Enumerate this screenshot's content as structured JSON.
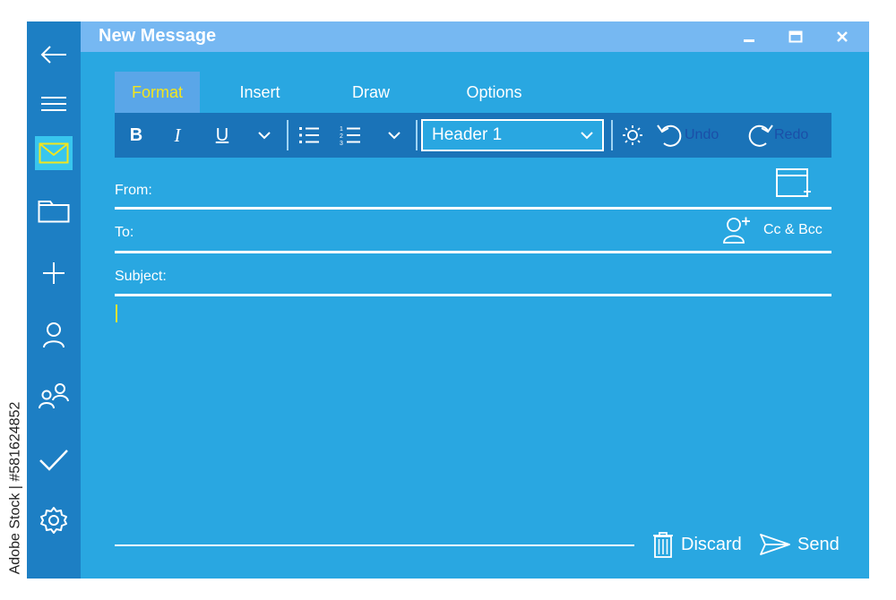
{
  "watermark_side": "Adobe Stock | #581624852",
  "window": {
    "title": "New Message",
    "controls": [
      "minimize",
      "maximize",
      "close"
    ]
  },
  "sidebar": {
    "items": [
      {
        "icon": "back-arrow-icon"
      },
      {
        "icon": "hamburger-menu-icon"
      },
      {
        "icon": "mail-icon",
        "active": true
      },
      {
        "icon": "folder-icon"
      },
      {
        "icon": "plus-icon"
      },
      {
        "icon": "person-icon"
      },
      {
        "icon": "people-icon"
      },
      {
        "icon": "checkmark-icon"
      },
      {
        "icon": "settings-gear-icon"
      }
    ]
  },
  "ribbon": {
    "tabs": [
      {
        "label": "Format",
        "active": true
      },
      {
        "label": "Insert"
      },
      {
        "label": "Draw"
      },
      {
        "label": "Options"
      }
    ]
  },
  "toolbar": {
    "bold": "B",
    "italic": "I",
    "underline": "U",
    "paragraph_style": "Header 1",
    "undo_label": "Undo",
    "redo_label": "Redo"
  },
  "fields": {
    "from_label": "From:",
    "to_label": "To:",
    "subject_label": "Subject:",
    "cc_bcc_label": "Cc & Bcc"
  },
  "actions": {
    "discard_label": "Discard",
    "send_label": "Send"
  },
  "colors": {
    "sidebar": "#1d7fc4",
    "window_body": "#29a7e1",
    "titlebar": "#76b8f2",
    "toolbar": "#1a73b8",
    "active_tab_text": "#f2e51e",
    "history_text": "#1b4fa8"
  }
}
